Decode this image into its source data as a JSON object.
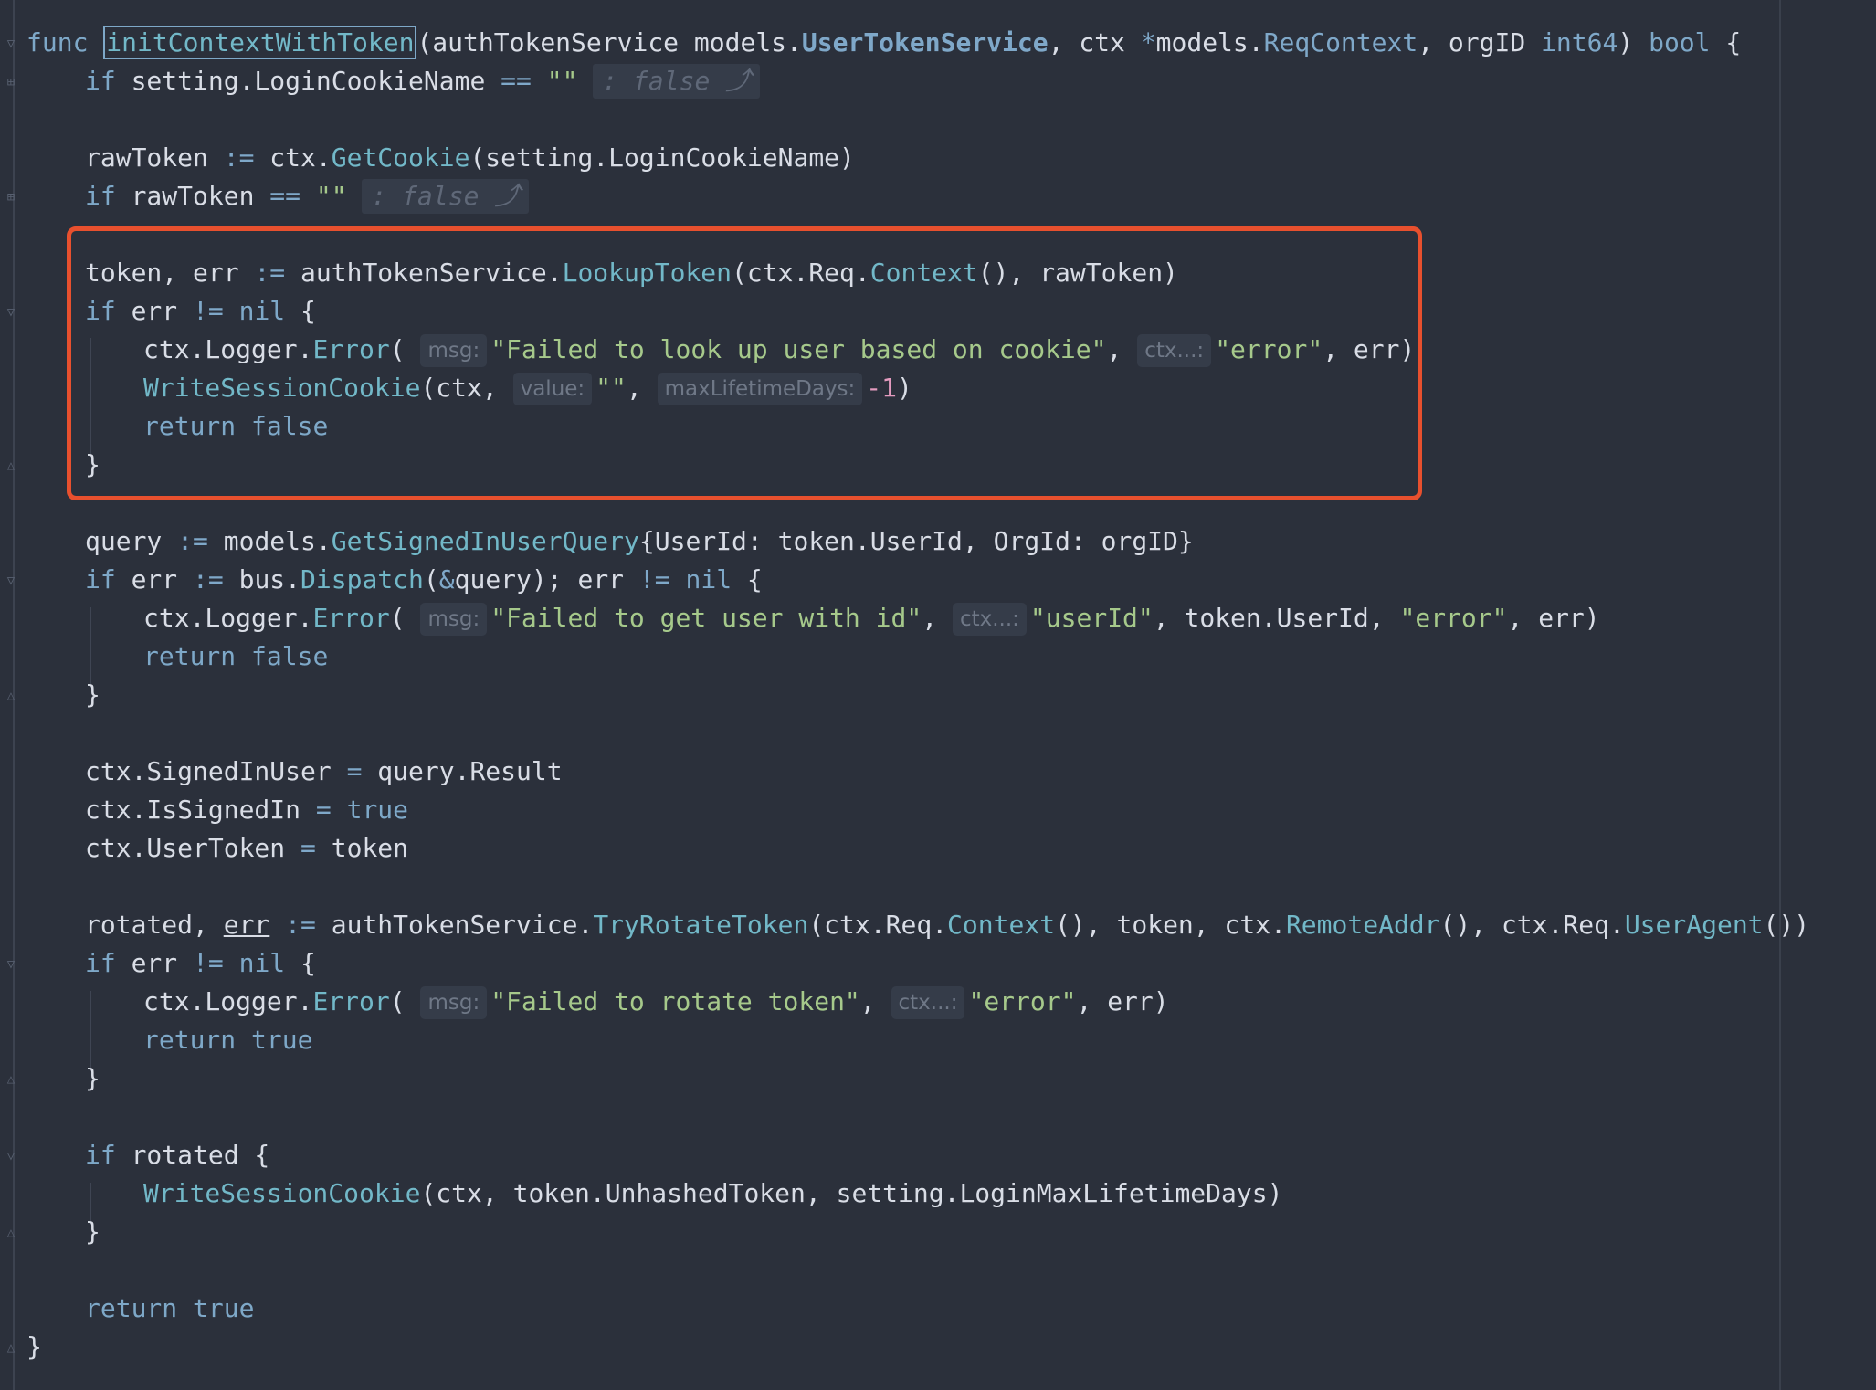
{
  "editor": {
    "function_keyword": "func",
    "function_name": "initContextWithToken",
    "signature_params": "(authTokenService models.",
    "signature_type1": "UserTokenService",
    "signature_params2": ", ctx ",
    "signature_star": "*",
    "signature_models": "models.",
    "signature_type2": "ReqContext",
    "signature_params3": ", orgID ",
    "signature_type3": "int64",
    "signature_params4": ") ",
    "signature_return": "bool",
    "signature_brace": " {",
    "hint_msg": "msg:",
    "hint_ctx": "ctx...:",
    "hint_value": "value:",
    "hint_max": "maxLifetimeDays:",
    "fold_false": ": false ⤴"
  }
}
